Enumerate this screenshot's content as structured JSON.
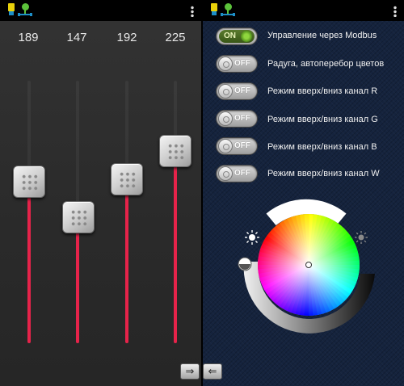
{
  "left_panel": {
    "values": [
      "189",
      "147",
      "192",
      "225"
    ],
    "levels": [
      189,
      147,
      192,
      225
    ],
    "level_max": 255,
    "fill_color": "#e6234a",
    "buttons": {
      "next_icon": "arrow-right-icon",
      "prev_icon": "arrow-left-icon",
      "next_glyph": "⇒",
      "prev_glyph": "⇐"
    }
  },
  "right_panel": {
    "toggles": [
      {
        "state": "ON",
        "label": "Управление через Modbus"
      },
      {
        "state": "OFF",
        "label": "Радуга, автоперебор цветов"
      },
      {
        "state": "OFF",
        "label": "Режим вверх/вниз канал R"
      },
      {
        "state": "OFF",
        "label": "Режим вверх/вниз канал G"
      },
      {
        "state": "OFF",
        "label": "Режим вверх/вниз канал B"
      },
      {
        "state": "OFF",
        "label": "Режим вверх/вниз канал W"
      }
    ],
    "color_wheel": {
      "brightness_icons": [
        "sun-bright-icon",
        "sun-dim-icon"
      ],
      "white_arc_color": "#ffffff"
    }
  },
  "status_bar": {
    "icons": [
      "warning-icon",
      "usb-tree-icon"
    ],
    "menu_icon": "overflow-menu-icon"
  }
}
